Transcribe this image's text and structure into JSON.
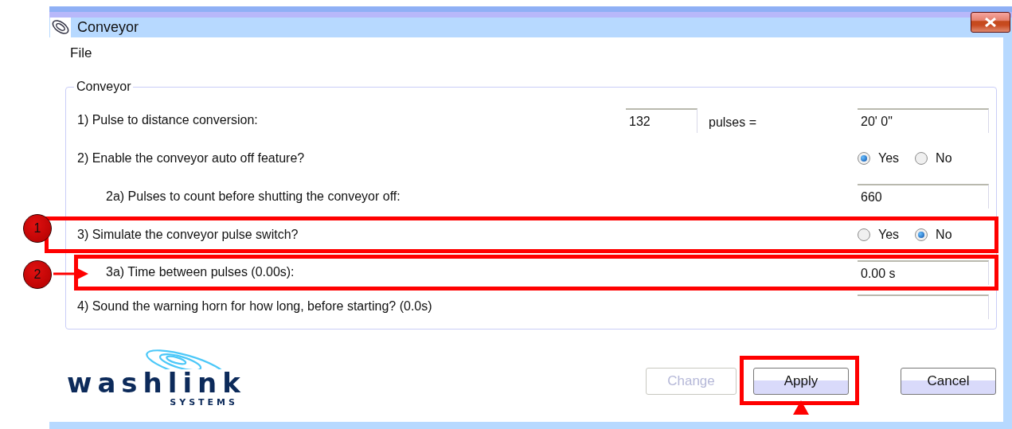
{
  "window": {
    "title": "Conveyor"
  },
  "menu": [
    {
      "label": "File"
    }
  ],
  "group": {
    "title": "Conveyor",
    "questions": [
      {
        "kind": "pulses",
        "label": "1) Pulse to distance conversion:",
        "value": "132",
        "unit": "pulses =",
        "result": "20' 0\"",
        "highlighted": false
      },
      {
        "kind": "radio",
        "label": "2) Enable the conveyor auto off feature?",
        "highlighted": false,
        "options": [
          {
            "label": "Yes",
            "selected": true
          },
          {
            "label": "No",
            "selected": false
          }
        ],
        "children": [
          {
            "kind": "field",
            "label": "2a) Pulses to count before shutting the conveyor off:",
            "value": "660",
            "highlighted": false
          }
        ]
      },
      {
        "kind": "radio",
        "label": "3) Simulate the conveyor pulse switch?",
        "highlighted": true,
        "marker": "1",
        "options": [
          {
            "label": "Yes",
            "selected": false
          },
          {
            "label": "No",
            "selected": true
          }
        ],
        "children": [
          {
            "kind": "field",
            "label": "3a) Time between pulses (0.00s):",
            "value": "0.00 s",
            "highlighted": true,
            "marker": "2"
          }
        ]
      },
      {
        "kind": "field",
        "label": "4) Sound the warning horn for how long, before starting? (0.0s)",
        "highlighted": false
      }
    ]
  },
  "logo": {
    "name": "washlink",
    "tagline": "SYSTEMS"
  },
  "buttons": [
    {
      "label": "Change",
      "disabled": true,
      "highlighted": false
    },
    {
      "label": "Apply",
      "disabled": false,
      "highlighted": true
    },
    {
      "label": "Cancel",
      "disabled": false,
      "highlighted": false
    }
  ]
}
